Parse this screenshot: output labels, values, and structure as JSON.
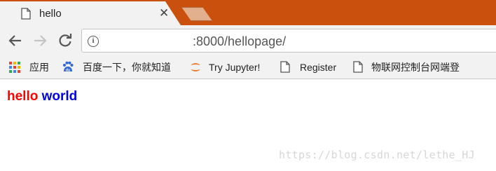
{
  "tab": {
    "title": "hello",
    "close_glyph": "✕"
  },
  "toolbar": {
    "back_icon": "back-arrow-icon",
    "forward_icon": "forward-arrow-icon",
    "reload_icon": "reload-icon",
    "info_glyph": "i",
    "url": ":8000/hellopage/"
  },
  "bookmarks": [
    {
      "label": "应用",
      "icon": "apps-grid-icon"
    },
    {
      "label": "百度一下，你就知道",
      "icon": "baidu-paw-icon"
    },
    {
      "label": "Try Jupyter!",
      "icon": "jupyter-icon"
    },
    {
      "label": "Register",
      "icon": "page-icon"
    },
    {
      "label": "物联网控制台网端登",
      "icon": "page-icon"
    }
  ],
  "page": {
    "hello": "hello",
    "world": "world"
  },
  "watermark": "https://blog.csdn.net/lethe_HJ",
  "colors": {
    "tabstrip": "#c9510d",
    "toolbar": "#f2f2f2",
    "hello": "#ff0000",
    "world": "#0000e6"
  }
}
